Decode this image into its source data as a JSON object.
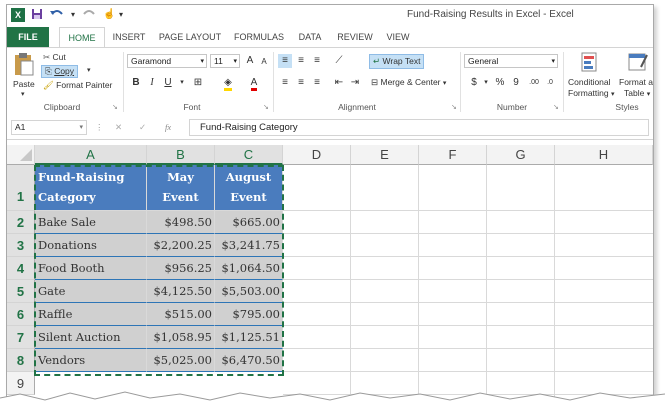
{
  "title_bar": {
    "app_icon": "X",
    "window_title": "Fund-Raising Results in Excel - Excel",
    "qat": [
      "save-icon",
      "undo-icon",
      "redo-icon",
      "touch-mode-icon",
      "customize-icon"
    ]
  },
  "tabs": [
    "FILE",
    "HOME",
    "INSERT",
    "PAGE LAYOUT",
    "FORMULAS",
    "DATA",
    "REVIEW",
    "VIEW"
  ],
  "ribbon": {
    "clipboard": {
      "paste": "Paste",
      "cut": "Cut",
      "copy": "Copy",
      "format_painter": "Format Painter",
      "label": "Clipboard"
    },
    "font": {
      "name": "Garamond",
      "size": "11",
      "bold": "B",
      "italic": "I",
      "underline": "U",
      "grow": "A",
      "shrink": "A",
      "font_color": "A",
      "label": "Font"
    },
    "alignment": {
      "wrap": "Wrap Text",
      "merge": "Merge & Center",
      "label": "Alignment"
    },
    "number": {
      "format": "General",
      "currency": "$",
      "percent": "%",
      "comma": "9",
      "label": "Number"
    },
    "styles": {
      "conditional": "Conditional",
      "conditional2": "Formatting",
      "format_as": "Format as",
      "format_as2": "Table",
      "label": "Styles"
    }
  },
  "formula_bar": {
    "name_box": "A1",
    "fx": "fx",
    "content": "Fund-Raising Category"
  },
  "grid": {
    "columns": [
      "A",
      "B",
      "C",
      "D",
      "E",
      "F",
      "G",
      "H"
    ],
    "rows": [
      "1",
      "2",
      "3",
      "4",
      "5",
      "6",
      "7",
      "8",
      "9"
    ],
    "headers": [
      [
        "Fund-Raising",
        "Category"
      ],
      [
        "May",
        "Event"
      ],
      [
        "August",
        "Event"
      ]
    ],
    "data": [
      [
        "Bake Sale",
        "$498.50",
        "$665.00"
      ],
      [
        "Donations",
        "$2,200.25",
        "$3,241.75"
      ],
      [
        "Food Booth",
        "$956.25",
        "$1,064.50"
      ],
      [
        "Gate",
        "$4,125.50",
        "$5,503.00"
      ],
      [
        "Raffle",
        "$515.00",
        "$795.00"
      ],
      [
        "Silent Auction",
        "$1,058.95",
        "$1,125.51"
      ],
      [
        "Vendors",
        "$5,025.00",
        "$6,470.50"
      ]
    ]
  },
  "colors": {
    "excel_green": "#217346",
    "header_blue": "#4a7cbe",
    "selection_gray": "#d0d0d0"
  }
}
